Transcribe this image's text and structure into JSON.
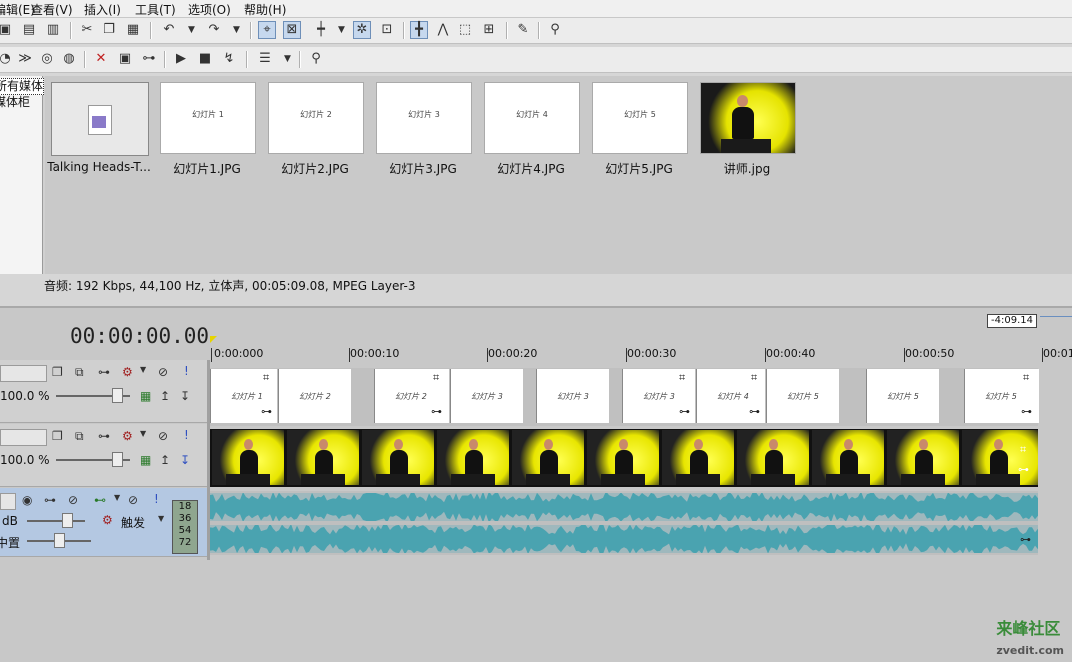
{
  "menu": [
    "编辑(E)",
    "查看(V)",
    "插入(I)",
    "工具(T)",
    "选项(O)",
    "帮助(H)"
  ],
  "tree": {
    "items": [
      "所有媒体",
      "媒体柜"
    ]
  },
  "media": {
    "items": [
      {
        "caption": "Talking Heads-T...",
        "type": "audio",
        "slide_text": ""
      },
      {
        "caption": "幻灯片1.JPG",
        "type": "slide",
        "slide_text": "幻灯片 1"
      },
      {
        "caption": "幻灯片2.JPG",
        "type": "slide",
        "slide_text": "幻灯片 2"
      },
      {
        "caption": "幻灯片3.JPG",
        "type": "slide",
        "slide_text": "幻灯片 3"
      },
      {
        "caption": "幻灯片4.JPG",
        "type": "slide",
        "slide_text": "幻灯片 4"
      },
      {
        "caption": "幻灯片5.JPG",
        "type": "slide",
        "slide_text": "幻灯片 5"
      },
      {
        "caption": "讲师.jpg",
        "type": "photo",
        "slide_text": ""
      }
    ],
    "status": "音频: 192 Kbps, 44,100 Hz, 立体声, 00:05:09.08, MPEG Layer-3"
  },
  "timeline": {
    "time": "00:00:00.00",
    "end_marker": "-4:09.14",
    "ruler": [
      "0:00:000",
      "00:00:10",
      "00:00:20",
      "00:00:30",
      "00:00:40",
      "00:00:50",
      "00:01"
    ],
    "tracks": {
      "slides": {
        "level": "100.0 %",
        "slide_labels": [
          "幻灯片 1",
          "幻灯片 2",
          "幻灯片 2",
          "幻灯片 3",
          "幻灯片 3",
          "幻灯片 3",
          "幻灯片 4",
          "幻灯片 5",
          "幻灯片 5",
          "幻灯片 5"
        ]
      },
      "video": {
        "level": "100.0 %"
      },
      "audio": {
        "volume_label": "dB",
        "pan_label": "中置",
        "trigger_label": "触发",
        "meter": [
          "18",
          "36",
          "54",
          "72"
        ]
      }
    }
  },
  "watermark": "来峰社区",
  "watermark_url": "zvedit.com",
  "colors": {
    "wave": "#4aa3b0",
    "accent": "#c6d8ee",
    "playhead": "#e6d400"
  }
}
